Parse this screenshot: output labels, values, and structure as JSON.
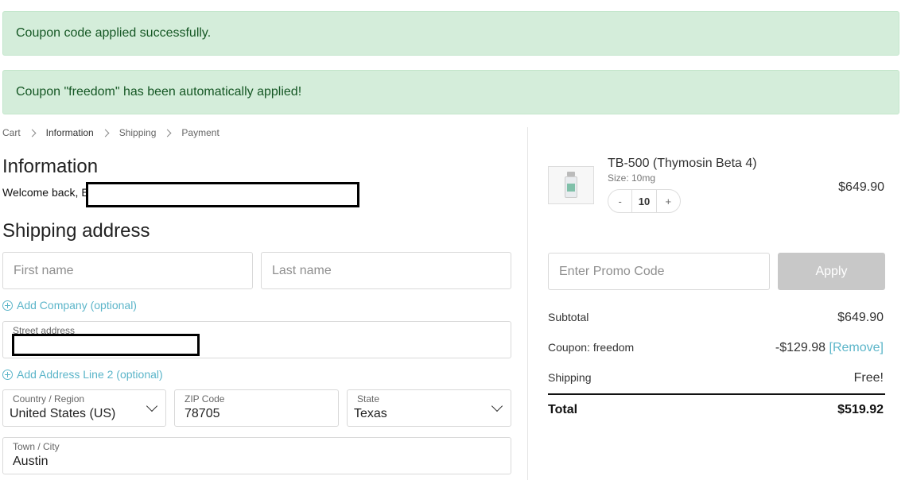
{
  "notices": {
    "coupon_success": "Coupon code applied successfully.",
    "coupon_auto": "Coupon \"freedom\" has been automatically applied!"
  },
  "breadcrumb": [
    "Cart",
    "Information",
    "Shipping",
    "Payment"
  ],
  "information": {
    "title": "Information",
    "welcome": "Welcome back, E"
  },
  "shipping": {
    "title": "Shipping address",
    "first_name_placeholder": "First name",
    "last_name_placeholder": "Last name",
    "add_company": "Add Company (optional)",
    "street_label": "Street address",
    "add_line2": "Add Address Line 2 (optional)",
    "country_label": "Country / Region",
    "country_value": "United States (US)",
    "zip_label": "ZIP Code",
    "zip_value": "78705",
    "state_label": "State",
    "state_value": "Texas",
    "city_label": "Town / City",
    "city_value": "Austin"
  },
  "cart": {
    "product_name": "TB-500 (Thymosin Beta 4)",
    "product_size": "Size: 10mg",
    "quantity": "10",
    "minus": "-",
    "plus": "+",
    "price": "$649.90"
  },
  "promo": {
    "placeholder": "Enter Promo Code",
    "apply_label": "Apply"
  },
  "summary": {
    "subtotal_label": "Subtotal",
    "subtotal_value": "$649.90",
    "coupon_label": "Coupon: freedom",
    "coupon_value": "-$129.98",
    "remove_label": "[Remove]",
    "shipping_label": "Shipping",
    "shipping_value": "Free!",
    "total_label": "Total",
    "total_value": "$519.92"
  },
  "colors": {
    "notice_bg": "#d4edda",
    "notice_text": "#155724",
    "link": "#5bb5c9",
    "apply_disabled": "#c8c8c8"
  }
}
